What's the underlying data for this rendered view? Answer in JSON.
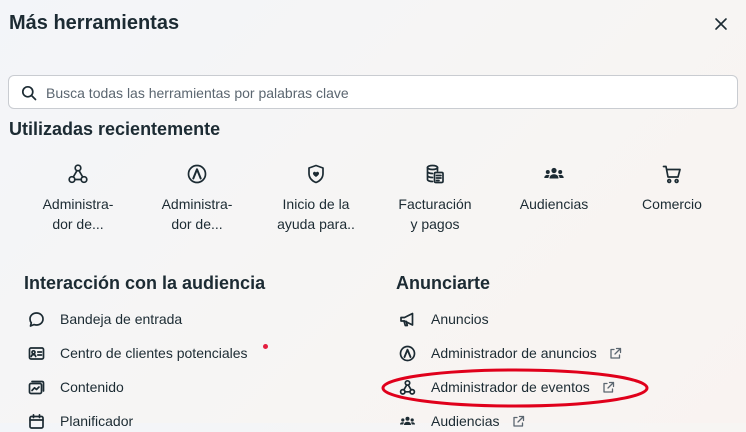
{
  "dialog": {
    "title": "Más herramientas"
  },
  "search": {
    "placeholder": "Busca todas las herramientas por palabras clave"
  },
  "recent": {
    "title": "Utilizadas recientemente",
    "items": [
      {
        "label": "Administra-\ndor de...",
        "icon": "events-manager-icon"
      },
      {
        "label": "Administra-\ndor de...",
        "icon": "ads-manager-icon"
      },
      {
        "label": "Inicio de la\nayuda para..",
        "icon": "shield-icon"
      },
      {
        "label": "Facturación\ny pagos",
        "icon": "billing-icon"
      },
      {
        "label": "Audiencias",
        "icon": "audiences-icon"
      },
      {
        "label": "Comercio",
        "icon": "cart-icon"
      }
    ]
  },
  "engagement": {
    "title": "Interacción con la audiencia",
    "items": [
      {
        "label": "Bandeja de entrada",
        "icon": "chat-bubble-icon"
      },
      {
        "label": "Centro de clientes potenciales",
        "icon": "contact-card-icon"
      },
      {
        "label": "Contenido",
        "icon": "content-icon"
      },
      {
        "label": "Planificador",
        "icon": "calendar-icon"
      }
    ]
  },
  "advertise": {
    "title": "Anunciarte",
    "items": [
      {
        "label": "Anuncios",
        "icon": "megaphone-icon"
      },
      {
        "label": "Administrador de anuncios",
        "icon": "ads-manager-icon",
        "external": true
      },
      {
        "label": "Administrador de eventos",
        "icon": "events-manager-icon",
        "external": true
      },
      {
        "label": "Audiencias",
        "icon": "audiences-icon",
        "external": true
      }
    ]
  },
  "colors": {
    "text": "#1c2b33",
    "notification_dot": "#e41e3f",
    "highlight_oval": "#e0001b"
  }
}
